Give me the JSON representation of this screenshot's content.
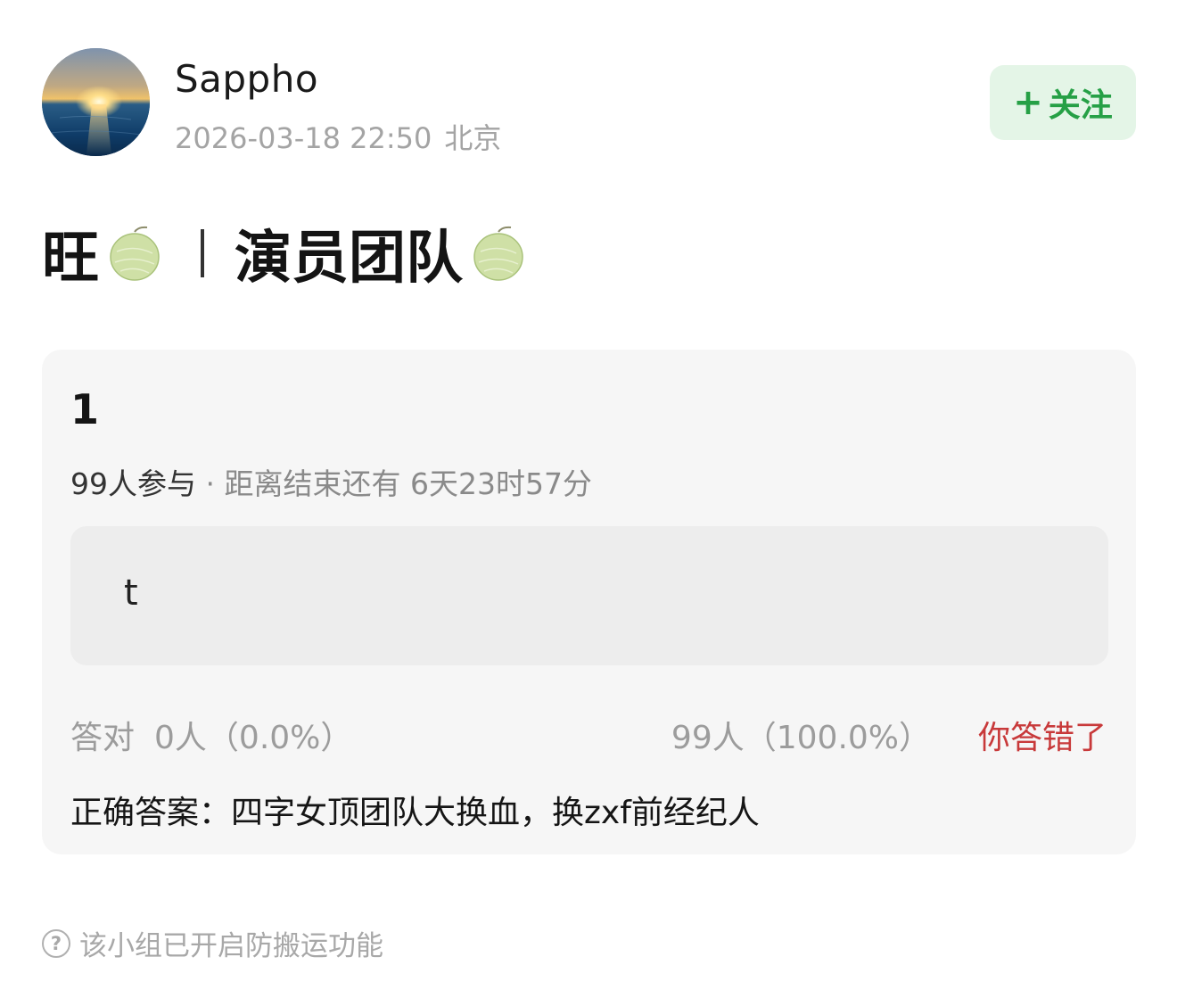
{
  "post": {
    "author": "Sappho",
    "datetime": "2026-03-18 22:50",
    "location": "北京",
    "follow_label": "关注",
    "follow_icon": "+",
    "title_part1": "旺",
    "title_part2": "演员团队",
    "emoji": "melon-emoji"
  },
  "quiz": {
    "number": "1",
    "participants": "99人参与",
    "time_left": " · 距离结束还有 6天23时57分",
    "option_text": "t",
    "correct_label": "答对",
    "correct_count": "0人（0.0%）",
    "wrong_count": "99人（100.0%）",
    "wrong_label": "你答错了",
    "answer": "正确答案：四字女顶团队大换血，换zxf前经纪人"
  },
  "footer": {
    "icon": "?",
    "notice": "该小组已开启防搬运功能"
  },
  "colors": {
    "follow_bg": "#e4f5e7",
    "follow_text": "#26a046",
    "wrong": "#c8393a",
    "card_bg": "#f6f6f6",
    "muted": "#a4a4a4"
  }
}
